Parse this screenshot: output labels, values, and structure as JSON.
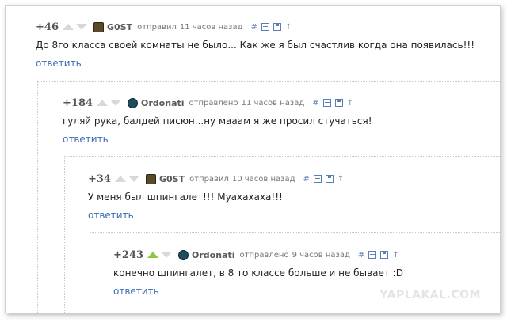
{
  "comments": [
    {
      "score": "+46",
      "user": "G0ST",
      "action": "отправил",
      "time": "11 часов назад",
      "text": "До 8го класса своей комнаты не было... Как же я был счастлив когда она появилась!!!",
      "reply": "ответить",
      "upvote_active": false
    },
    {
      "score": "+184",
      "user": "Ordonati",
      "action": "отправлено",
      "time": "11 часов назад",
      "text": "гуляй рука, балдей писюн...ну мааам я же просил стучаться!",
      "reply": "ответить",
      "upvote_active": false
    },
    {
      "score": "+34",
      "user": "G0ST",
      "action": "отправил",
      "time": "10 часов назад",
      "text": "У меня был шпингалет!!! Муахахаха!!!",
      "reply": "ответить",
      "upvote_active": false
    },
    {
      "score": "+243",
      "user": "Ordonati",
      "action": "отправлено",
      "time": "9 часов назад",
      "text": "конечно шпингалет, в 8 то классе больше и не бывает :D",
      "reply": "ответить",
      "upvote_active": true
    }
  ],
  "tools": {
    "hash": "#",
    "up_arrow": "↑"
  },
  "colors": {
    "accent": "#3a6cb5",
    "upvote_active": "#8dc63f",
    "vote_inactive": "#d8d8d8"
  },
  "icons": [
    "vote-up-icon",
    "vote-down-icon",
    "avatar-icon",
    "permalink-icon",
    "collapse-icon",
    "save-icon",
    "parent-arrow-icon"
  ],
  "watermark": "YAPLAKAL.COM"
}
